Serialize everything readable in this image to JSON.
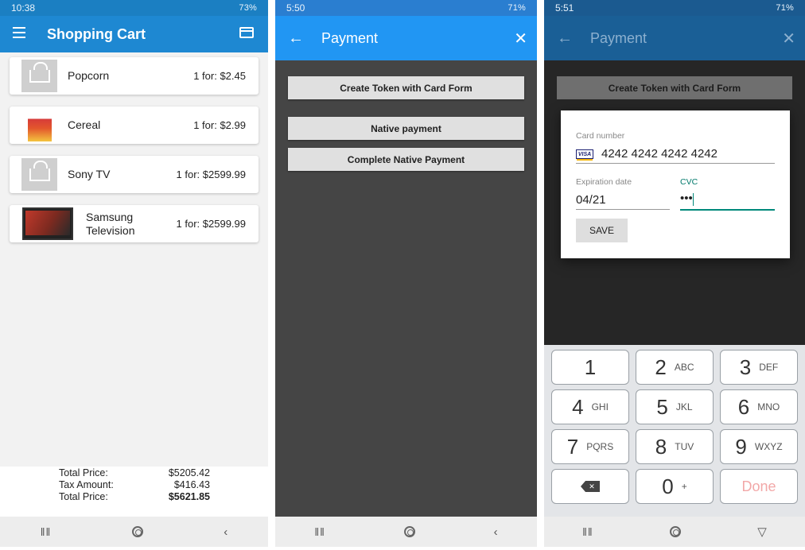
{
  "screen1": {
    "status": {
      "time": "10:38",
      "right": "73%"
    },
    "title": "Shopping Cart",
    "products": [
      {
        "name": "Popcorn",
        "price": "1 for: $2.45",
        "thumb": "no-product-image"
      },
      {
        "name": "Cereal",
        "price": "1 for: $2.99",
        "thumb": "cereal-box"
      },
      {
        "name": "Sony TV",
        "price": "1 for: $2599.99",
        "thumb": "no-product-image"
      },
      {
        "name": "Samsung Television",
        "price": "1 for: $2599.99",
        "thumb": "tv-image"
      }
    ],
    "totals": [
      {
        "label": "Total Price:",
        "value": "$5205.42"
      },
      {
        "label": "Tax Amount:",
        "value": "$416.43"
      },
      {
        "label": "Total Price:",
        "value": "$5621.85"
      }
    ]
  },
  "screen2": {
    "status": {
      "time": "5:50",
      "right": "71%"
    },
    "title": "Payment",
    "buttons": [
      "Create Token with Card Form",
      "Native payment",
      "Complete Native Payment"
    ]
  },
  "screen3": {
    "status": {
      "time": "5:51",
      "right": "71%"
    },
    "title": "Payment",
    "background_button": "Create Token with Card Form",
    "dialog": {
      "card_number_label": "Card number",
      "card_number": "4242 4242 4242 4242",
      "card_brand": "VISA",
      "expiration_label": "Expiration date",
      "expiration": "04/21",
      "cvc_label": "CVC",
      "cvc": "•••",
      "save_label": "SAVE"
    },
    "keypad": [
      {
        "num": "1",
        "letters": ""
      },
      {
        "num": "2",
        "letters": "ABC"
      },
      {
        "num": "3",
        "letters": "DEF"
      },
      {
        "num": "4",
        "letters": "GHI"
      },
      {
        "num": "5",
        "letters": "JKL"
      },
      {
        "num": "6",
        "letters": "MNO"
      },
      {
        "num": "7",
        "letters": "PQRS"
      },
      {
        "num": "8",
        "letters": "TUV"
      },
      {
        "num": "9",
        "letters": "WXYZ"
      },
      {
        "num": "",
        "letters": ""
      },
      {
        "num": "0",
        "letters": "+"
      },
      {
        "num": "Done",
        "letters": ""
      }
    ]
  },
  "navbar": {
    "recent": "‖‖",
    "back": "‹"
  },
  "colors": {
    "appbar_blue": "#1e88d2",
    "payment_blue": "#2196f3",
    "accent_teal": "#00897b"
  }
}
